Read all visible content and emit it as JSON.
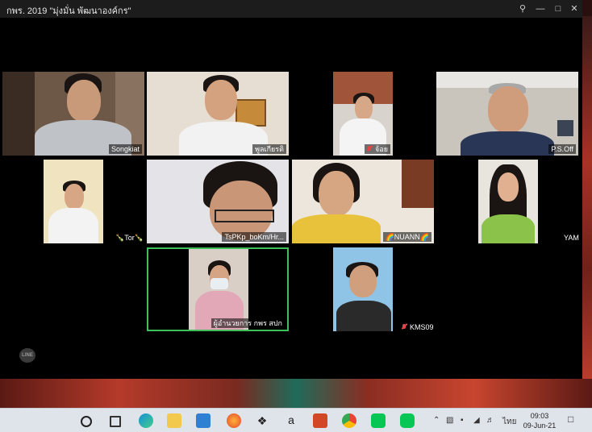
{
  "window": {
    "title": "กพร. 2019 \"มุ่งมั่น พัฒนาองค์กร\""
  },
  "participants": [
    {
      "name": "Songkiat",
      "muted": false
    },
    {
      "name": "พูลเกียรติ",
      "muted": false
    },
    {
      "name": "จ้อย",
      "muted": true
    },
    {
      "name": "P.S.Off",
      "muted": false
    },
    {
      "name": "🍾Tor🍾",
      "muted": false
    },
    {
      "name": "TsPKp_boKm/Hr...",
      "muted": false
    },
    {
      "name": "🌈NUANN🌈",
      "muted": false
    },
    {
      "name": "YAM",
      "muted": false
    },
    {
      "name": "ผู้อำนวยการ กพร สปก",
      "muted": false,
      "active_speaker": true
    },
    {
      "name": "KMS09",
      "muted": true
    }
  ],
  "taskbar": {
    "apps": [
      "search-circle-icon",
      "task-view-icon",
      "edge-icon",
      "file-explorer-icon",
      "mail-icon",
      "firefox-icon",
      "dropbox-icon",
      "amazon-icon",
      "powerpoint-icon",
      "chrome-icon",
      "line-icon",
      "line-call-icon"
    ],
    "language": "ไทย",
    "time": "09:03",
    "date": "09-Jun-21"
  },
  "overlay": {
    "logo_text": "LINE"
  },
  "colors": {
    "active_speaker_border": "#3fbf5a",
    "window_bg": "#000000"
  }
}
